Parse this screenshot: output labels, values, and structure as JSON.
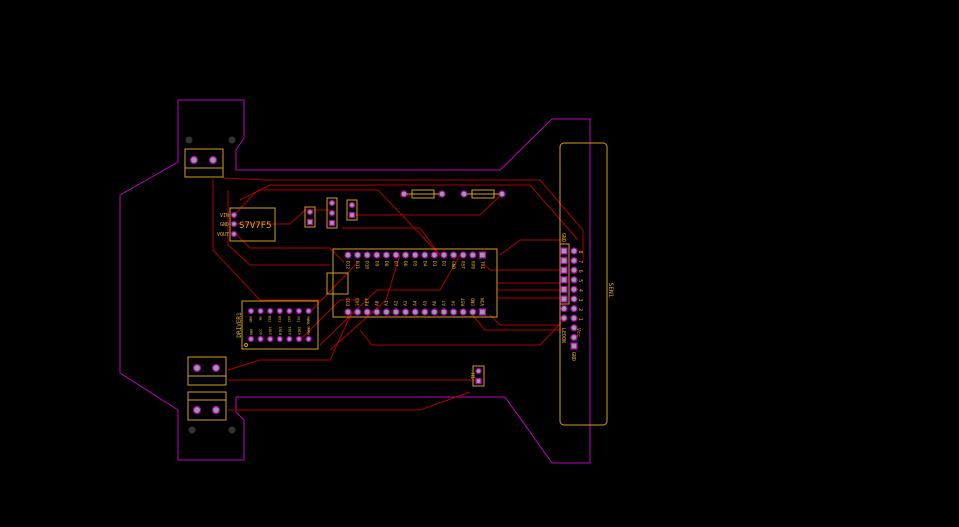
{
  "regulator": {
    "ref": "S7V7F5",
    "pins": [
      "VIN",
      "GND",
      "VOUT"
    ]
  },
  "driver": {
    "ref": "DRIVER1",
    "top_pins": [
      "GND",
      "VM",
      "BO2",
      "BO1",
      "AO2",
      "AO1",
      "PWMA"
    ],
    "bottom_pins": [
      "GND",
      "VCC",
      "STBY",
      "BIN1",
      "AIN1",
      "AIN2",
      "PWMB"
    ]
  },
  "arduino": {
    "top_pins": [
      "D12",
      "D11",
      "D10",
      "D9",
      "D8",
      "D7",
      "D6",
      "D5",
      "D4",
      "D3",
      "D2",
      "GND",
      "RST",
      "RX0",
      "TX1"
    ],
    "bottom_pins": [
      "D13",
      "3V3",
      "REF",
      "A0",
      "A1",
      "A2",
      "A3",
      "A4",
      "A5",
      "A6",
      "A7",
      "5V",
      "RST",
      "GND",
      "VIN"
    ]
  },
  "sensor": {
    "ref": "SEN1",
    "left_labels": [
      "GND",
      "LEDON"
    ],
    "numbers": [
      "8",
      "7",
      "6",
      "5",
      "4",
      "3",
      "2",
      "1"
    ],
    "right_labels": [
      "Vcc",
      "GND"
    ]
  },
  "header": {
    "ref": "H1"
  },
  "colors": {
    "edge": "#c000c0",
    "silk": "#d4a017",
    "trace": "#b00000"
  }
}
